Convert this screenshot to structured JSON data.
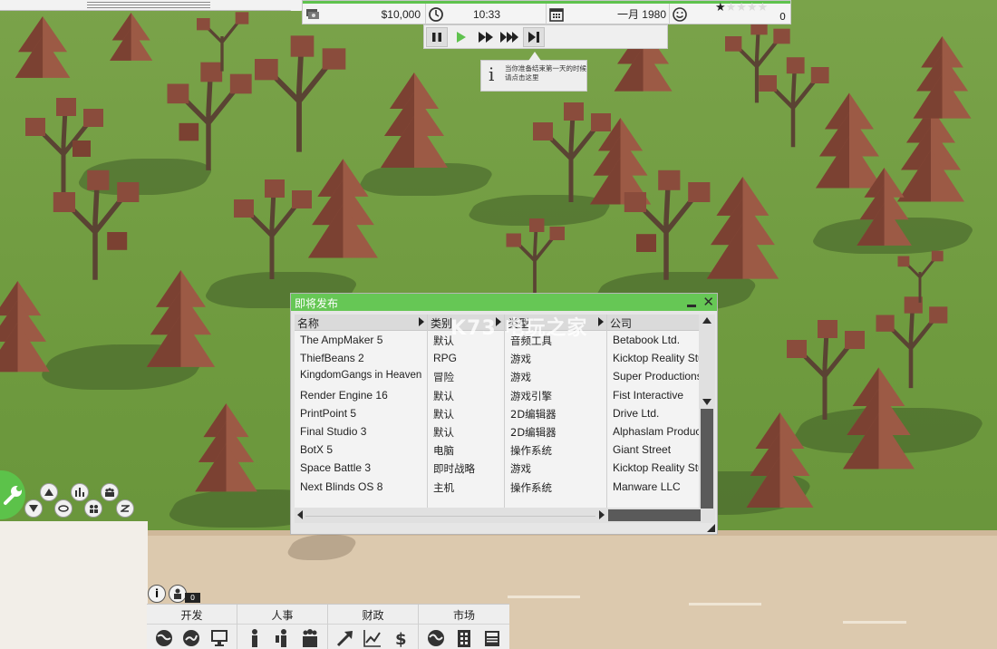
{
  "top_bar": {
    "money": "$10,000",
    "time": "10:33",
    "date": "一月 1980",
    "rating_stars": 1,
    "rating_max": 5,
    "rating_count": "0"
  },
  "speed_controls": {
    "icons": [
      "pause-icon",
      "play-icon",
      "fast-forward-icon",
      "fastest-forward-icon",
      "skip-day-icon"
    ],
    "tooltip": "当你准备结束第一天的时候请点击这里"
  },
  "release_window": {
    "title": "即将发布",
    "columns": [
      "名称",
      "类别",
      "类型",
      "公司"
    ],
    "rows": [
      {
        "name": "The AmpMaker 5",
        "category": "默认",
        "type": "音频工具",
        "company": "Betabook Ltd."
      },
      {
        "name": "ThiefBeans 2",
        "category": "RPG",
        "type": "游戏",
        "company": "Kicktop Reality Stu"
      },
      {
        "name": "KingdomGangs in Heaven",
        "category": "冒险",
        "type": "游戏",
        "company": "Super Productions"
      },
      {
        "name": "Render Engine 16",
        "category": "默认",
        "type": "游戏引擎",
        "company": "Fist Interactive"
      },
      {
        "name": "PrintPoint 5",
        "category": "默认",
        "type": "2D编辑器",
        "company": "Drive Ltd."
      },
      {
        "name": "Final Studio 3",
        "category": "默认",
        "type": "2D编辑器",
        "company": "Alphaslam Produc"
      },
      {
        "name": "BotX 5",
        "category": "电脑",
        "type": "操作系统",
        "company": "Giant Street"
      },
      {
        "name": "Space Battle 3",
        "category": "即时战略",
        "type": "游戏",
        "company": "Kicktop Reality Stu"
      },
      {
        "name": "Next Blinds OS 8",
        "category": "主机",
        "type": "操作系统",
        "company": "Manware LLC"
      }
    ]
  },
  "watermark": "K73 电玩之家",
  "bottom_bar": {
    "categories": [
      {
        "label": "开发",
        "icons": [
          "globe-icon",
          "globe-alt-icon",
          "computer-icon"
        ]
      },
      {
        "label": "人事",
        "icons": [
          "person-icon",
          "staff-icon",
          "team-icon"
        ]
      },
      {
        "label": "财政",
        "icons": [
          "trend-arrow-icon",
          "line-chart-icon",
          "dollar-icon"
        ]
      },
      {
        "label": "市场",
        "icons": [
          "world-icon",
          "building-icon",
          "newspaper-icon"
        ]
      }
    ],
    "notification_count": "0"
  },
  "colors": {
    "accent_green": "#5fc24e",
    "window_title": "#66c755",
    "grass": "#6e9a3e",
    "road": "#dcc9ae"
  }
}
